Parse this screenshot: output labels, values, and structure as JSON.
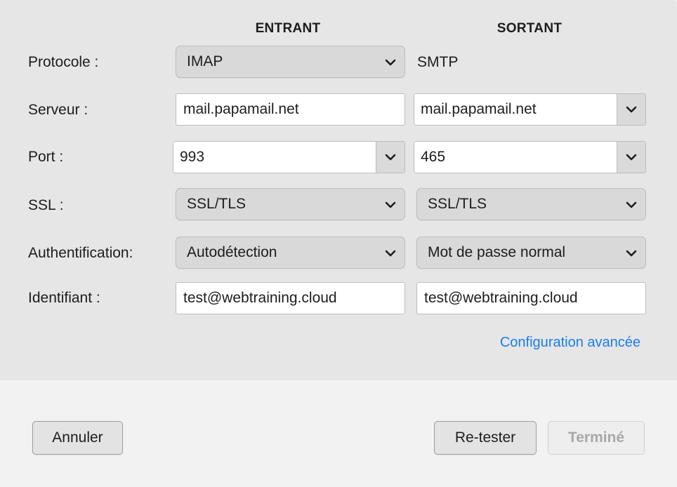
{
  "columns": {
    "incoming": "ENTRANT",
    "outgoing": "SORTANT"
  },
  "rows": {
    "protocol": {
      "label": "Protocole :",
      "incoming": "IMAP",
      "outgoing": "SMTP"
    },
    "server": {
      "label": "Serveur :",
      "incoming": "mail.papamail.net",
      "outgoing": "mail.papamail.net"
    },
    "port": {
      "label": "Port :",
      "incoming": "993",
      "outgoing": "465"
    },
    "ssl": {
      "label": "SSL :",
      "incoming": "SSL/TLS",
      "outgoing": "SSL/TLS"
    },
    "auth": {
      "label": "Authentification:",
      "incoming": "Autodétection",
      "outgoing": "Mot de passe normal"
    },
    "username": {
      "label": "Identifiant :",
      "incoming": "test@webtraining.cloud",
      "outgoing": "test@webtraining.cloud"
    }
  },
  "advanced_link": "Configuration avancée",
  "buttons": {
    "cancel": "Annuler",
    "retest": "Re-tester",
    "done": "Terminé"
  },
  "colors": {
    "link": "#1a7ee6",
    "panel": "#e6e6e6",
    "footer": "#f2f2f2"
  }
}
